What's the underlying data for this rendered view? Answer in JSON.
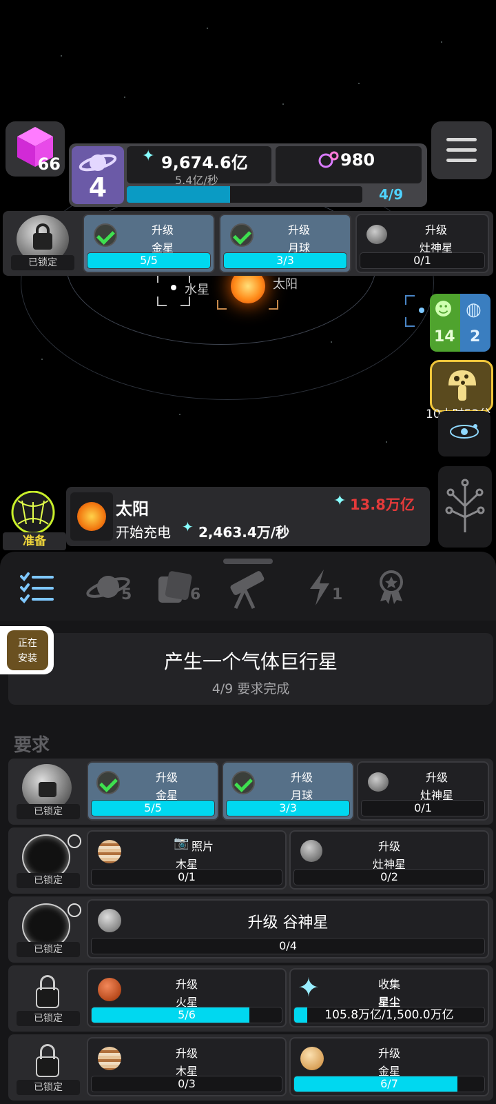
{
  "resources": {
    "cubes": "66",
    "level": "4",
    "stardust": "9,674.6亿",
    "stardust_rate": "5.4亿/秒",
    "orbs": "980",
    "progress_label": "4/9",
    "progress_fraction": 0.44
  },
  "top_requirements": {
    "locked_label": "已锁定",
    "items": [
      {
        "line1": "升级",
        "line2": "金星",
        "progress": "5/5",
        "fraction": 1.0,
        "done": true
      },
      {
        "line1": "升级",
        "line2": "月球",
        "progress": "3/3",
        "fraction": 1.0,
        "done": true
      },
      {
        "line1": "升级",
        "line2": "灶神星",
        "progress": "0/1",
        "fraction": 0,
        "done": false
      }
    ]
  },
  "solar_system": {
    "mercury_label": "水星",
    "sun_label": "太阳"
  },
  "side_buttons": {
    "dino_count": "14",
    "globe_count": "2",
    "timer": "10小时53分"
  },
  "selection": {
    "ready_label": "准备",
    "name": "太阳",
    "cost": "13.8万亿",
    "status": "开始充电",
    "rate": "2,463.4万/秒"
  },
  "tabs": [
    {
      "name": "tasks",
      "count": ""
    },
    {
      "name": "planets",
      "count": "5"
    },
    {
      "name": "cards",
      "count": "6"
    },
    {
      "name": "telescope",
      "count": ""
    },
    {
      "name": "energy",
      "count": "1"
    },
    {
      "name": "achievements",
      "count": ""
    }
  ],
  "installing": {
    "line1": "正在",
    "line2": "安装"
  },
  "goal": {
    "title": "产生一个气体巨行星",
    "subtitle": "4/9 要求完成"
  },
  "requirements_heading": "要求",
  "requirement_rows": [
    {
      "locked_label": "已锁定",
      "items": [
        {
          "line1": "升级",
          "line2": "金星",
          "progress": "5/5",
          "fraction": 1.0
        },
        {
          "line1": "升级",
          "line2": "月球",
          "progress": "3/3",
          "fraction": 1.0
        },
        {
          "line1": "升级",
          "line2": "灶神星",
          "progress": "0/1",
          "fraction": 0
        }
      ]
    },
    {
      "locked_label": "已锁定",
      "items": [
        {
          "line1": "照片",
          "line2": "木星",
          "progress": "0/1",
          "fraction": 0
        },
        {
          "line1": "升级",
          "line2": "灶神星",
          "progress": "0/2",
          "fraction": 0
        }
      ]
    },
    {
      "locked_label": "已锁定",
      "items": [
        {
          "line1": "升级 谷神星",
          "progress": "0/4",
          "fraction": 0
        }
      ]
    },
    {
      "locked_label": "已锁定",
      "items": [
        {
          "line1": "升级",
          "line2": "火星",
          "progress": "5/6",
          "fraction": 0.83
        },
        {
          "line1": "收集",
          "line2": "星尘",
          "progress": "105.8万亿/1,500.0万亿",
          "fraction": 0.07
        }
      ]
    },
    {
      "locked_label": "已锁定",
      "items": [
        {
          "line1": "升级",
          "line2": "木星",
          "progress": "0/3",
          "fraction": 0
        },
        {
          "line1": "升级",
          "line2": "金星",
          "progress": "6/7",
          "fraction": 0.86
        }
      ]
    }
  ]
}
